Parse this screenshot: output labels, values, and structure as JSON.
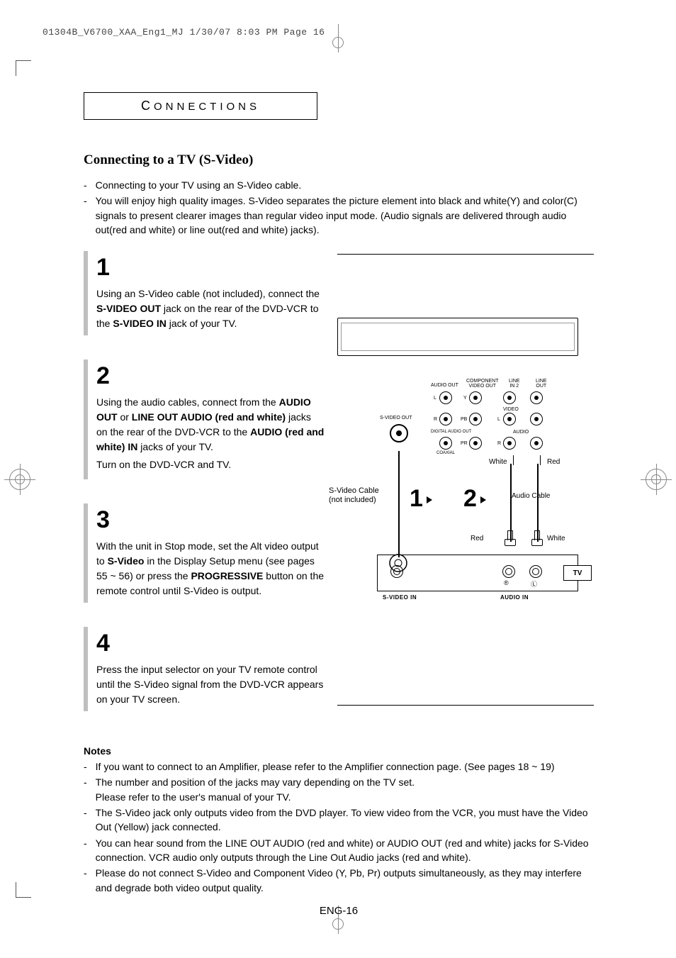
{
  "header_line": "01304B_V6700_XAA_Eng1_MJ  1/30/07  8:03 PM  Page 16",
  "section_label_cap": "C",
  "section_label_rest": "ONNECTIONS",
  "subtitle": "Connecting to a TV (S-Video)",
  "intro": [
    "Connecting to your TV using an S-Video cable.",
    "You will enjoy high quality images. S-Video separates the picture element into black and white(Y) and color(C) signals to present clearer images than regular video input mode. (Audio signals are delivered through audio out(red and white) or line out(red and white) jacks)."
  ],
  "steps": [
    {
      "num": "1",
      "paragraphs": [
        "Using an S-Video cable (not included), connect the <b>S-VIDEO OUT</b> jack on the rear of the DVD-VCR to the <b>S-VIDEO IN</b> jack of your TV."
      ]
    },
    {
      "num": "2",
      "paragraphs": [
        "Using the audio cables, connect from the <b>AUDIO OUT</b> or <b>LINE OUT AUDIO (red and white)</b> jacks on the rear of the DVD-VCR to the <b>AUDIO (red and white) IN</b> jacks of your TV.",
        "Turn on the DVD-VCR and TV."
      ]
    },
    {
      "num": "3",
      "paragraphs": [
        "With the unit in Stop mode, set the Alt video output to <b>S-Video</b> in the Display Setup menu (see pages 55 ~ 56) or press the <b>PROGRESSIVE</b> button on the remote control until S-Video is output."
      ]
    },
    {
      "num": "4",
      "paragraphs": [
        "Press the input selector on your TV remote control until the S-Video signal from the DVD-VCR appears on your TV screen."
      ]
    }
  ],
  "diagram": {
    "back_labels": {
      "audio_out": "AUDIO OUT",
      "component": "COMPONENT\nVIDEO OUT",
      "line_in2": "LINE\nIN 2",
      "line_out": "LINE\nOUT",
      "video": "VIDEO",
      "svideo_out": "S-VIDEO OUT",
      "digital_audio": "DIGITAL AUDIO OUT",
      "coaxial": "COAXIAL",
      "audio": "AUDIO",
      "l": "L",
      "r": "R",
      "y": "Y",
      "pb": "PB",
      "pr": "PR"
    },
    "white": "White",
    "red": "Red",
    "cable_note": "S-Video Cable\n(not included)",
    "audio_cable": "Audio Cable",
    "big1": "1",
    "big2": "2",
    "tv": "TV",
    "svideo_in": "S-VIDEO IN",
    "audio_in": "AUDIO IN",
    "r_sym": "®",
    "l_sym": "Ⓛ"
  },
  "notes_head": "Notes",
  "notes": [
    "If you want to connect to an Amplifier, please refer to the Amplifier connection page. (See pages 18 ~ 19)",
    "The number and position of the jacks may vary depending on the TV set.\nPlease refer to the user's manual of your TV.",
    "The S-Video jack only outputs video from the DVD player. To view video from the VCR, you must have the Video Out (Yellow) jack connected.",
    "You can hear sound from the LINE OUT AUDIO (red and white) or AUDIO OUT (red and white) jacks for S-Video connection. VCR audio only outputs through the Line Out Audio jacks (red and white).",
    "Please do not connect S-Video and Component Video (Y, Pb, Pr) outputs simultaneously, as they may interfere and degrade both video output quality."
  ],
  "page_num": "ENG-16"
}
